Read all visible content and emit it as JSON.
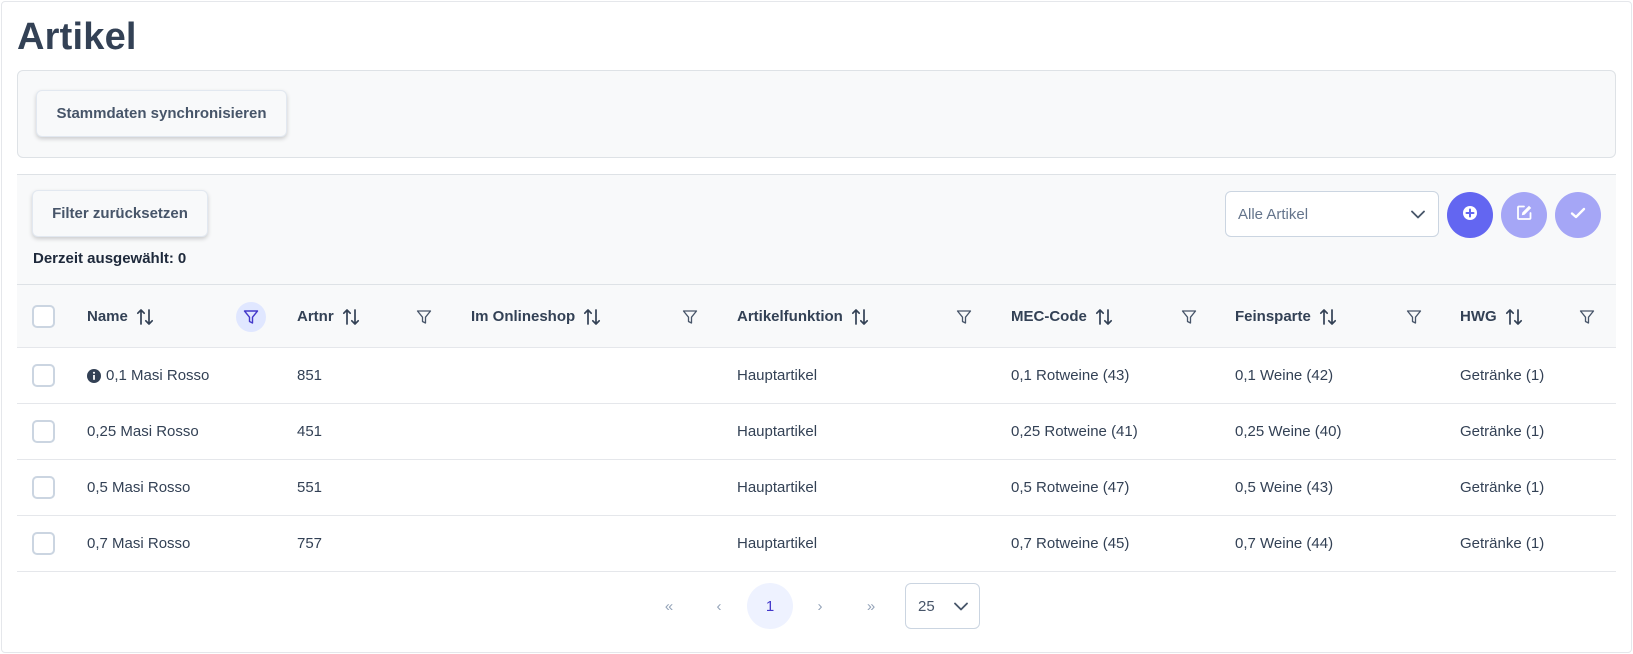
{
  "page": {
    "title": "Artikel"
  },
  "toolbar": {
    "sync_label": "Stammdaten synchronisieren",
    "reset_label": "Filter zurücksetzen",
    "selected_label": "Derzeit ausgewählt:",
    "selected_count": "0",
    "view_select": "Alle Artikel",
    "accent_color": "#6366f1"
  },
  "table": {
    "columns": [
      {
        "label": "Name",
        "filter_active": true
      },
      {
        "label": "Artnr",
        "filter_active": false
      },
      {
        "label": "Im Onlineshop",
        "filter_active": false
      },
      {
        "label": "Artikelfunktion",
        "filter_active": false
      },
      {
        "label": "MEC-Code",
        "filter_active": false
      },
      {
        "label": "Feinsparte",
        "filter_active": false
      },
      {
        "label": "HWG",
        "filter_active": false
      }
    ],
    "rows": [
      {
        "name": "0,1 Masi Rosso",
        "has_info": true,
        "artnr": "851",
        "onlineshop": "",
        "funktion": "Hauptartikel",
        "mec": "0,1 Rotweine (43)",
        "feinsparte": "0,1 Weine (42)",
        "hwg": "Getränke (1)"
      },
      {
        "name": "0,25 Masi Rosso",
        "has_info": false,
        "artnr": "451",
        "onlineshop": "",
        "funktion": "Hauptartikel",
        "mec": "0,25 Rotweine (41)",
        "feinsparte": "0,25 Weine (40)",
        "hwg": "Getränke (1)"
      },
      {
        "name": "0,5 Masi Rosso",
        "has_info": false,
        "artnr": "551",
        "onlineshop": "",
        "funktion": "Hauptartikel",
        "mec": "0,5 Rotweine (47)",
        "feinsparte": "0,5 Weine (43)",
        "hwg": "Getränke (1)"
      },
      {
        "name": "0,7 Masi Rosso",
        "has_info": false,
        "artnr": "757",
        "onlineshop": "",
        "funktion": "Hauptartikel",
        "mec": "0,7 Rotweine (45)",
        "feinsparte": "0,7 Weine (44)",
        "hwg": "Getränke (1)"
      }
    ]
  },
  "pagination": {
    "first": "«",
    "prev": "‹",
    "current_page": "1",
    "next": "›",
    "last": "»",
    "page_size": "25"
  }
}
